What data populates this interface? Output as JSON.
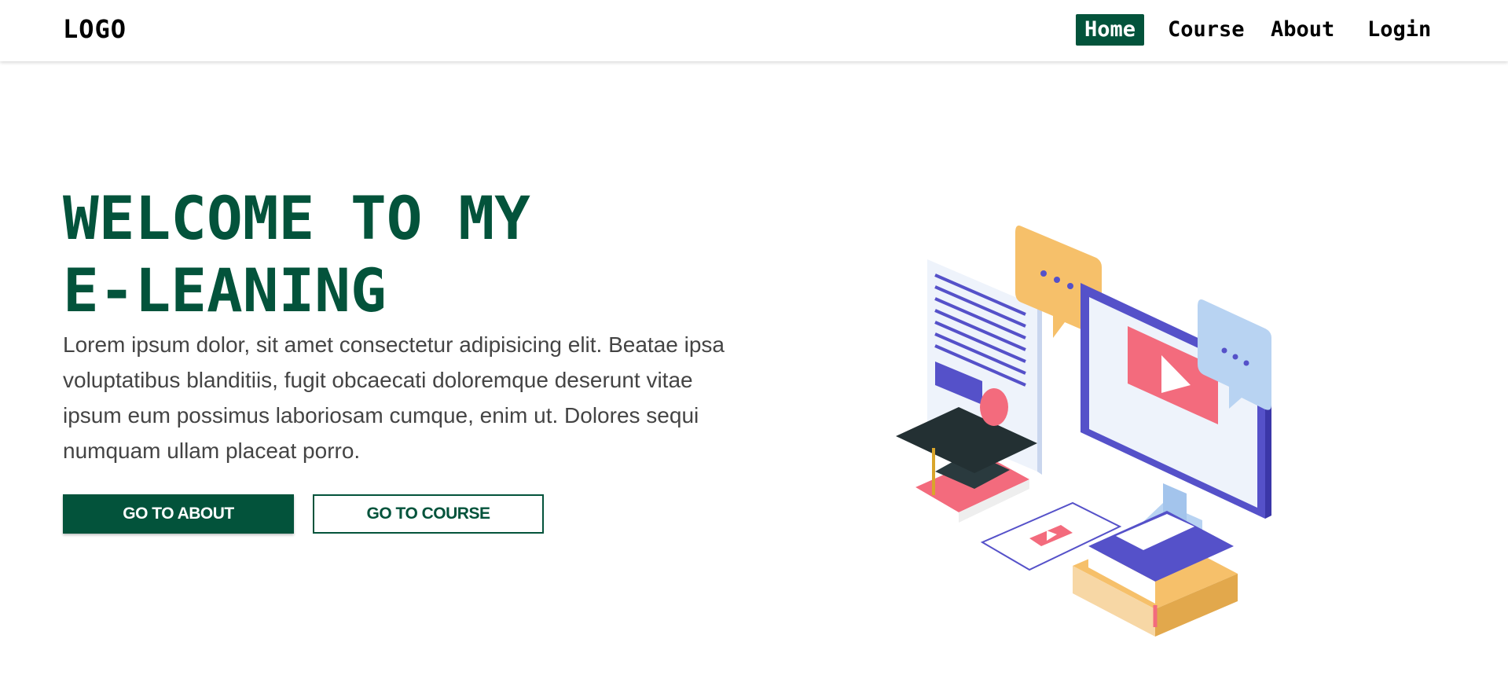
{
  "header": {
    "logo": "LOGO",
    "nav": [
      {
        "label": "Home",
        "active": true
      },
      {
        "label": "Course",
        "active": false
      },
      {
        "label": "About",
        "active": false
      },
      {
        "label": "Login",
        "active": false
      }
    ]
  },
  "hero": {
    "title_line1": "WELCOME TO MY",
    "title_line2": "E-LEANING",
    "text": "Lorem ipsum dolor, sit amet consectetur adipisicing elit. Beatae ipsa voluptatibus blanditiis, fugit obcaecati doloremque deserunt vitae ipsum eum possimus laboriosam cumque, enim ut. Dolores sequi numquam ullam placeat porro.",
    "btn_about": "Go to about",
    "btn_course": "Go to course"
  },
  "colors": {
    "brand": "#03533b",
    "illustration_blue": "#5551c9",
    "illustration_pink": "#f36b7d",
    "illustration_yellow": "#f6c06a"
  },
  "illustration": {
    "icons": [
      "document-icon",
      "chat-bubble-icon",
      "monitor-icon",
      "play-icon",
      "graduation-cap-icon",
      "tablet-icon",
      "books-icon"
    ]
  }
}
